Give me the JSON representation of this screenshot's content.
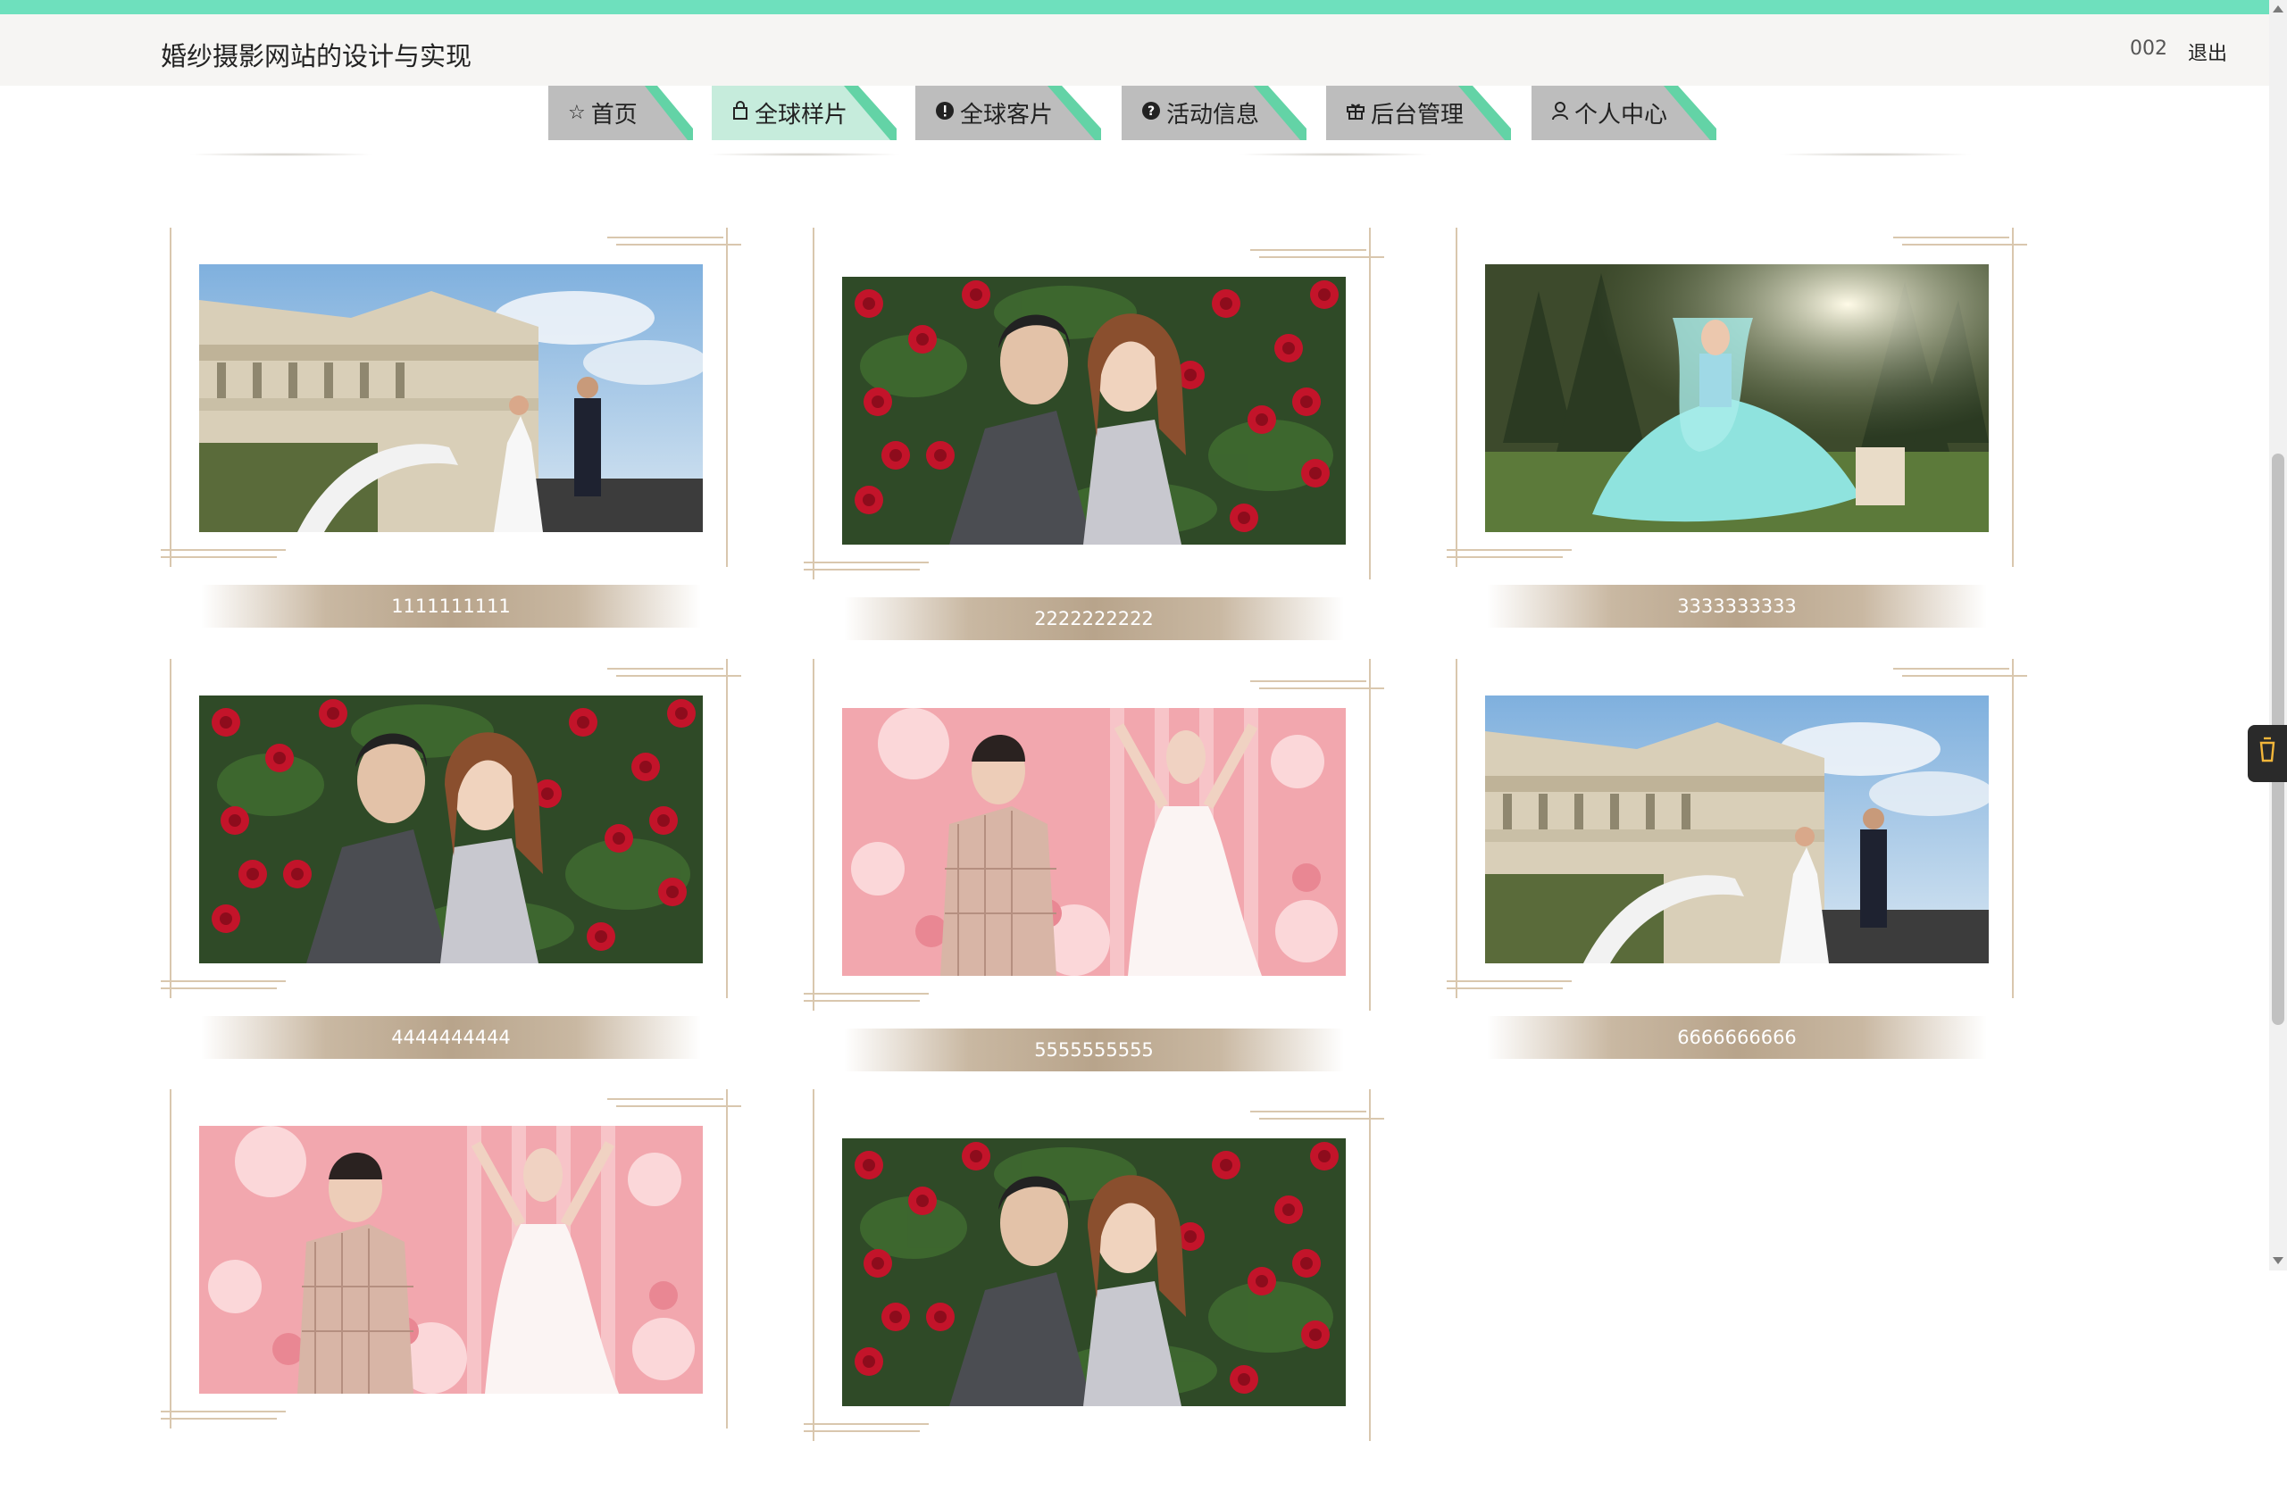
{
  "header": {
    "site_title": "婚纱摄影网站的设计与实现",
    "user_name": "002",
    "logout_label": "退出"
  },
  "nav": {
    "items": [
      {
        "label": "首页",
        "icon": "star-icon",
        "active": false
      },
      {
        "label": "全球样片",
        "icon": "bag-icon",
        "active": true
      },
      {
        "label": "全球客片",
        "icon": "exclamation-circle-icon",
        "active": false
      },
      {
        "label": "活动信息",
        "icon": "question-circle-icon",
        "active": false
      },
      {
        "label": "后台管理",
        "icon": "gift-icon",
        "active": false
      },
      {
        "label": "个人中心",
        "icon": "user-icon",
        "active": false
      }
    ]
  },
  "gallery": {
    "items": [
      {
        "title": "1111111111",
        "scene": "castle-couple"
      },
      {
        "title": "2222222222",
        "scene": "rose-couple"
      },
      {
        "title": "3333333333",
        "scene": "garden-dress"
      },
      {
        "title": "4444444444",
        "scene": "rose-couple"
      },
      {
        "title": "5555555555",
        "scene": "pink-studio"
      },
      {
        "title": "6666666666",
        "scene": "castle-couple"
      },
      {
        "title": "",
        "scene": "pink-studio"
      },
      {
        "title": "",
        "scene": "rose-couple"
      }
    ]
  },
  "colors": {
    "top_bar": "#6ee0bd",
    "header_bg": "#f6f5f3",
    "tab_inactive": "#bdbdbd",
    "tab_active": "#c6ecdc",
    "tab_corner": "#63d3a6",
    "caption_bar": "#b8a48b",
    "frame_line": "#d9c7ae"
  },
  "side_widget": {
    "icon": "cup-icon"
  }
}
